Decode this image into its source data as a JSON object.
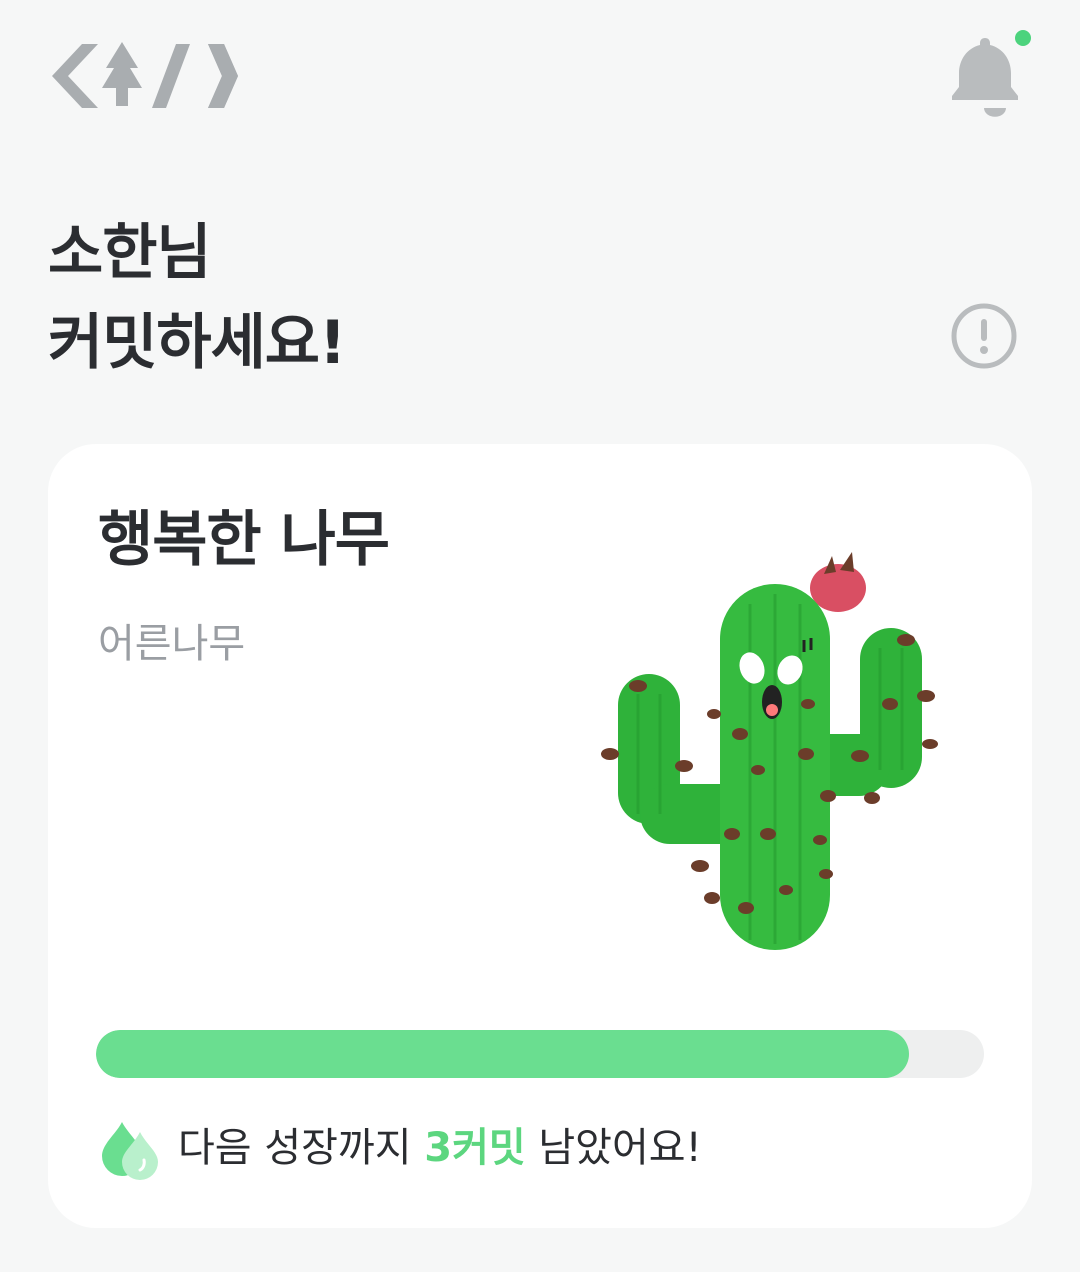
{
  "header": {
    "logo_icon": "code-tree-logo",
    "notification_icon": "bell-icon",
    "has_unread": true,
    "unread_dot_color": "#4cd37d"
  },
  "greeting": {
    "line1": "소한님",
    "line2": "커밋하세요!",
    "info_icon": "exclamation-circle-icon"
  },
  "tree_card": {
    "name": "행복한 나무",
    "level": "어른나무",
    "illustration": "cactus-character",
    "progress_fraction": 0.915,
    "progress_color": "#6ade90",
    "drops_icon": "water-drops-icon",
    "next_growth_prefix": "다음 성장까지 ",
    "next_growth_count": "3커밋",
    "next_growth_suffix": " 남았어요!",
    "highlight_color": "#5cd67f"
  }
}
